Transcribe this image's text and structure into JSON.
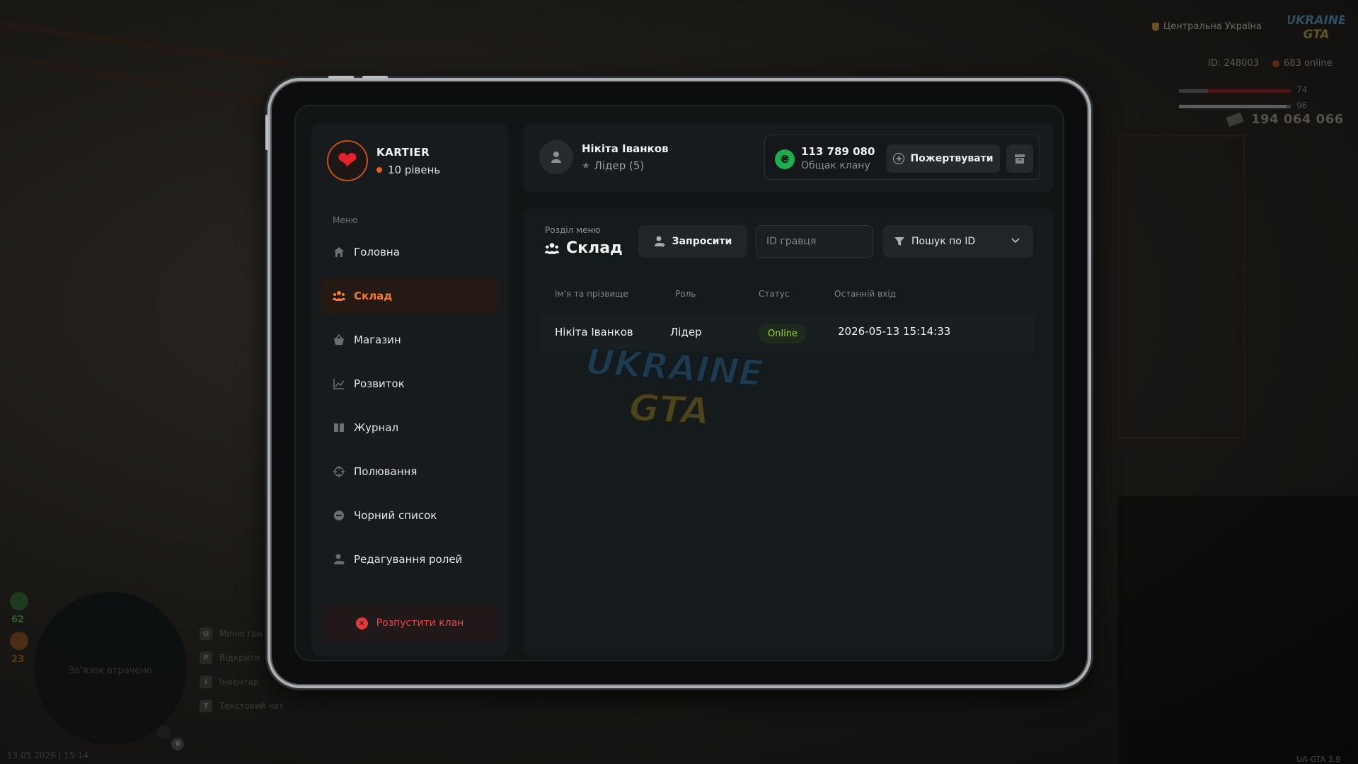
{
  "hud": {
    "region": "Центральна Україна",
    "logo_line1": "UKRAINE",
    "logo_line2": "GTA",
    "id_text": "ID: 248003",
    "online_text": "683 online",
    "health": 74,
    "armor": 96,
    "money": "194 064 066",
    "minimap_text": "Зв'язок втрачено",
    "stat_1": "62",
    "stat_2": "23",
    "keyhints": [
      {
        "key": "O",
        "label": "Меню гри"
      },
      {
        "key": "P",
        "label": "Відкрити"
      },
      {
        "key": "I",
        "label": "Інвентар"
      },
      {
        "key": "T",
        "label": "Текстовий чат"
      }
    ],
    "mic_badge": "Я",
    "datetime": "13.05.2026 | 15:14",
    "version": "UA-GTA 3.9"
  },
  "clan": {
    "name": "KARTIER",
    "level": "10 рівень"
  },
  "menu": {
    "caption": "Меню",
    "items": [
      {
        "label": "Головна",
        "icon": "home-icon"
      },
      {
        "label": "Склад",
        "icon": "people-icon",
        "active": true
      },
      {
        "label": "Магазин",
        "icon": "basket-icon"
      },
      {
        "label": "Розвиток",
        "icon": "chart-icon"
      },
      {
        "label": "Журнал",
        "icon": "book-icon"
      },
      {
        "label": "Полювання",
        "icon": "crosshair-icon"
      },
      {
        "label": "Чорний список",
        "icon": "block-icon"
      },
      {
        "label": "Редагування ролей",
        "icon": "user-edit-icon"
      }
    ],
    "disband_label": "Розпустити клан"
  },
  "header": {
    "user_name": "Нікіта Іванков",
    "user_role": "Лідер (5)",
    "treasury_amount": "113 789 080",
    "treasury_label": "Общак клану",
    "donate_label": "Пожертвувати"
  },
  "section": {
    "caption": "Розділ меню",
    "title": "Склад",
    "invite_label": "Запросити",
    "id_placeholder": "ID гравця",
    "filter_label": "Пошук по ID"
  },
  "table": {
    "columns": [
      "Ім'я та прізвище",
      "Роль",
      "Статус",
      "Останній вхід"
    ],
    "rows": [
      {
        "name": "Нікіта Іванков",
        "role": "Лідер",
        "status": "Online",
        "last_login": "2026-05-13 15:14:33"
      }
    ]
  },
  "watermark": {
    "line1": "UKRAINE",
    "line2": "GTA"
  },
  "colors": {
    "accent": "#f07c2d",
    "danger": "#ee4848",
    "online": "#9ad03c",
    "coin": "#1fae4f"
  }
}
